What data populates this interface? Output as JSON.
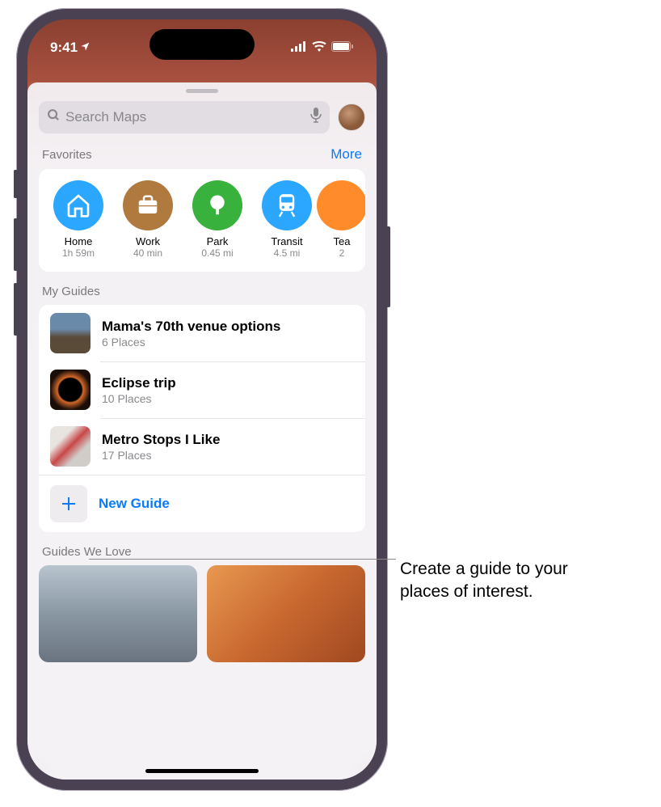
{
  "status": {
    "time": "9:41",
    "location_active": true
  },
  "search": {
    "placeholder": "Search Maps"
  },
  "favorites": {
    "title": "Favorites",
    "action": "More",
    "items": [
      {
        "name": "Home",
        "sub": "1h 59m",
        "color": "#2ca7ff",
        "icon": "home"
      },
      {
        "name": "Work",
        "sub": "40 min",
        "color": "#b07a3e",
        "icon": "briefcase"
      },
      {
        "name": "Park",
        "sub": "0.45 mi",
        "color": "#38b23c",
        "icon": "tree"
      },
      {
        "name": "Transit",
        "sub": "4.5 mi",
        "color": "#2ca7ff",
        "icon": "train"
      },
      {
        "name": "Tea",
        "sub": "2",
        "color": "#ff8b2b",
        "icon": "pin"
      }
    ]
  },
  "myGuides": {
    "title": "My Guides",
    "items": [
      {
        "title": "Mama's 70th venue options",
        "sub": "6 Places"
      },
      {
        "title": "Eclipse trip",
        "sub": "10 Places"
      },
      {
        "title": "Metro Stops I Like",
        "sub": "17 Places"
      }
    ],
    "newGuide": "New Guide"
  },
  "guidesWeLove": {
    "title": "Guides We Love"
  },
  "callout": {
    "line1": "Create a guide to your",
    "line2": "places of interest."
  }
}
